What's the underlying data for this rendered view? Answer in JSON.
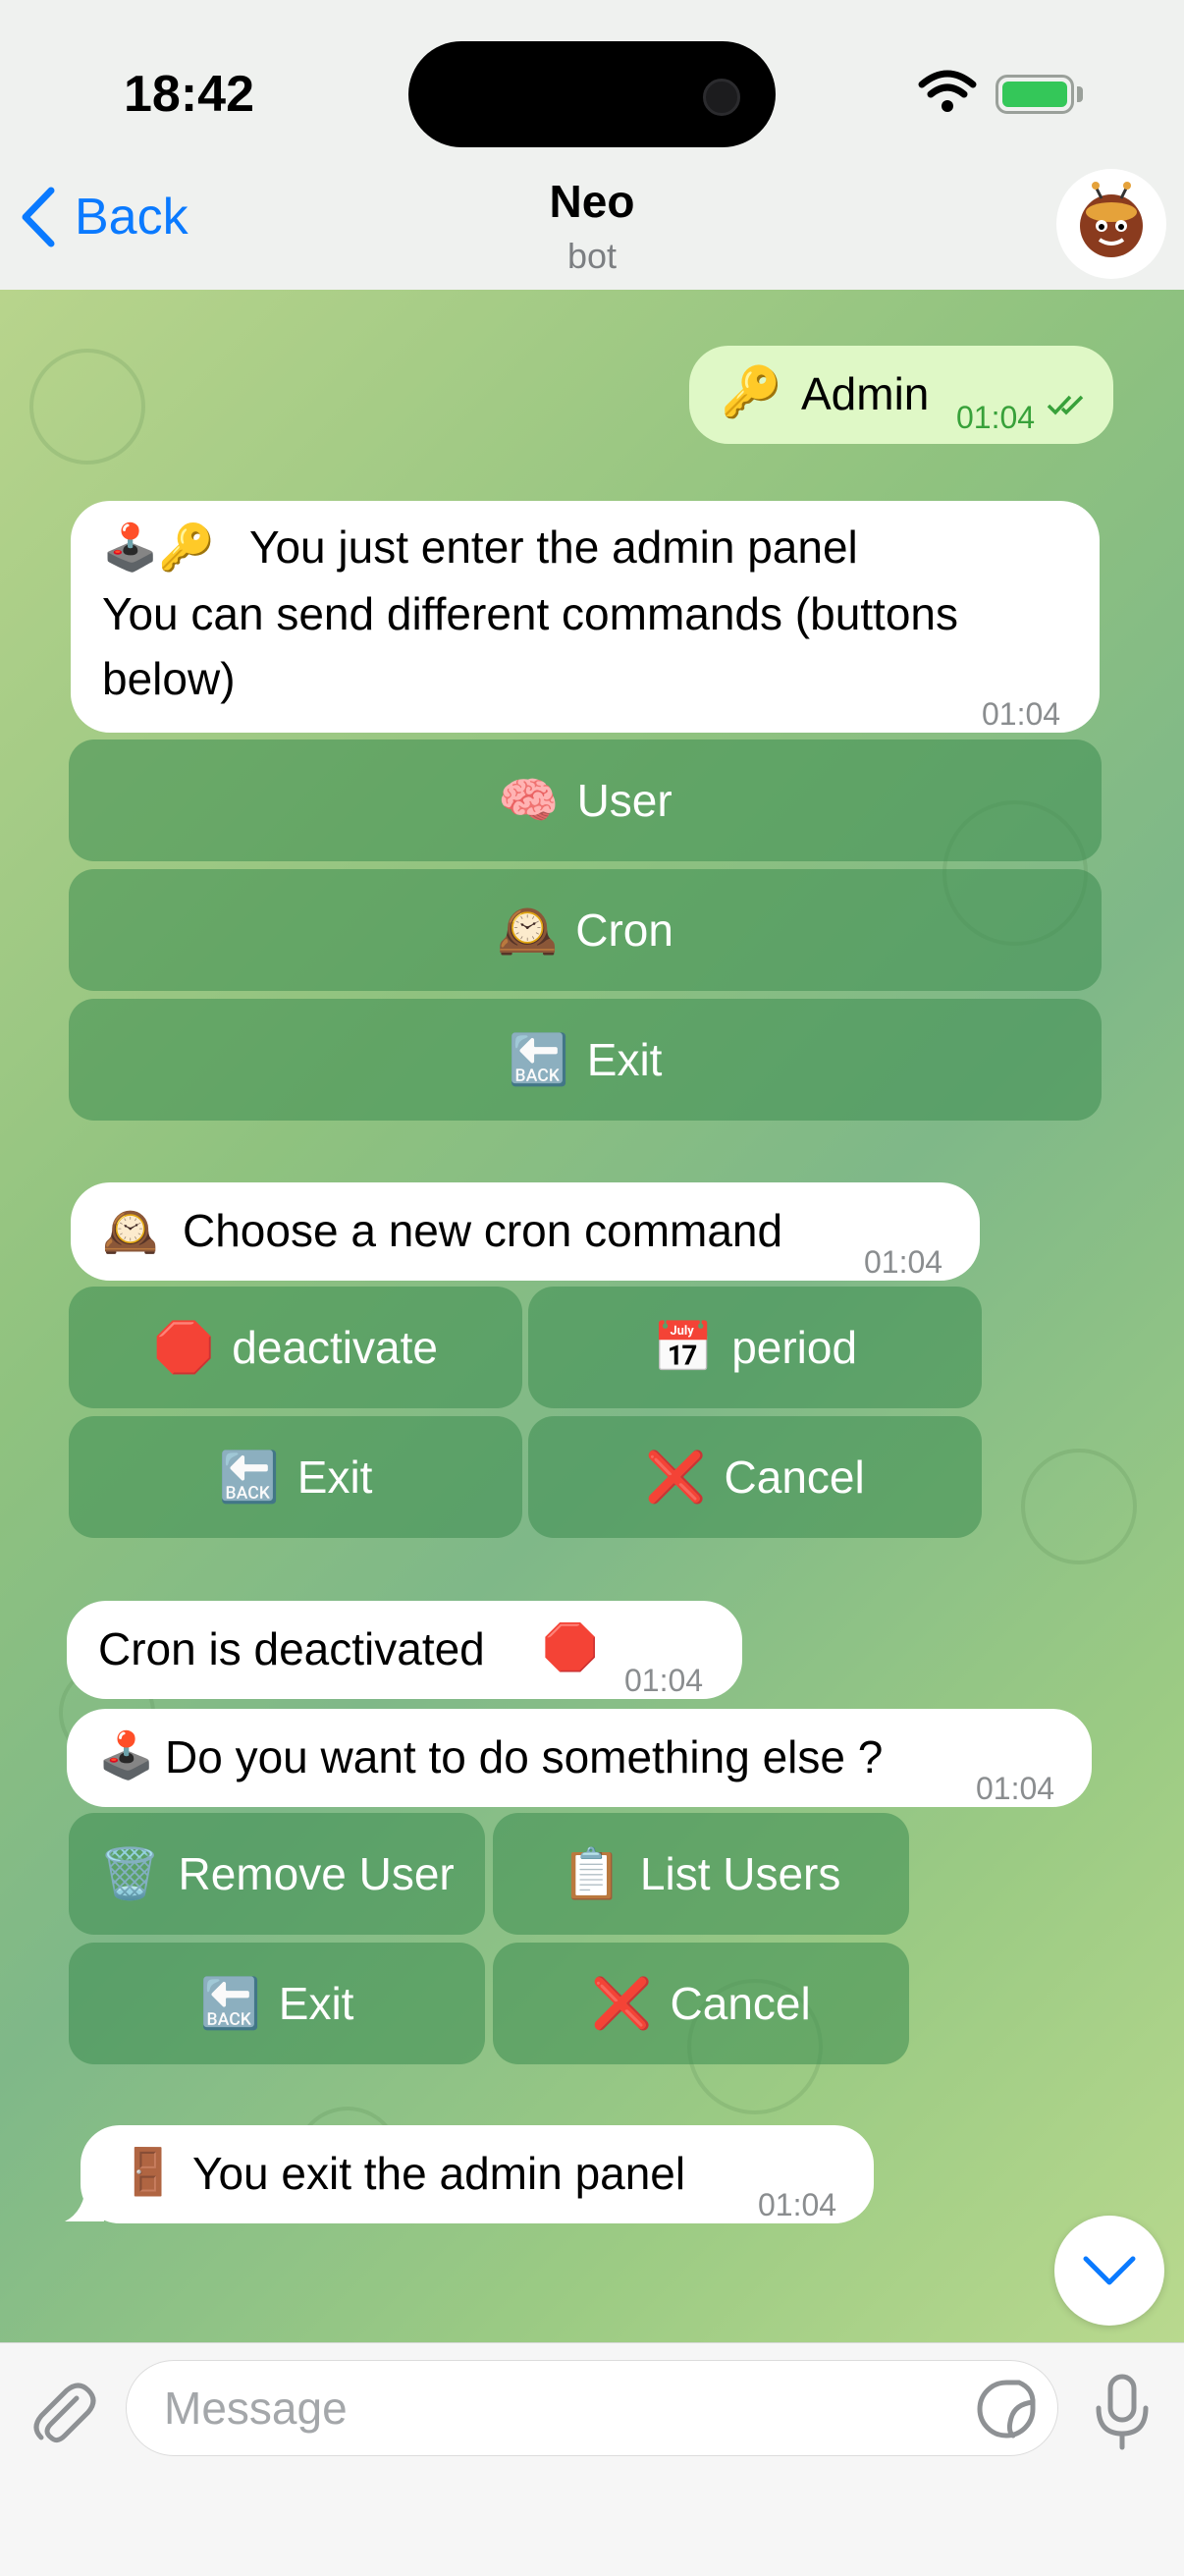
{
  "status_bar": {
    "time": "18:42"
  },
  "header": {
    "back_label": "Back",
    "title": "Neo",
    "subtitle": "bot"
  },
  "messages": {
    "m1": {
      "emoji": "🔑",
      "text": "Admin",
      "time": "01:04"
    },
    "m2": {
      "emoji": "🕹️🔑",
      "line1": "You just enter the admin panel",
      "line2": "You can send different commands (buttons",
      "line3": "below)",
      "time": "01:04",
      "buttons": [
        {
          "icon": "🧠",
          "label": "User"
        },
        {
          "icon": "🕰️",
          "label": "Cron"
        },
        {
          "icon": "🔙",
          "label": "Exit"
        }
      ]
    },
    "m3": {
      "emoji": "🕰️",
      "text": "Choose a new cron command",
      "time": "01:04",
      "buttons": [
        {
          "icon": "🛑",
          "label": "deactivate"
        },
        {
          "icon": "📅",
          "label": "period"
        },
        {
          "icon": "🔙",
          "label": "Exit"
        },
        {
          "icon": "❌",
          "label": "Cancel"
        }
      ]
    },
    "m4": {
      "text": "Cron is deactivated",
      "emoji": "🛑",
      "time": "01:04"
    },
    "m5": {
      "emoji": "🕹️",
      "text": "Do you want to do something else ?",
      "time": "01:04",
      "buttons": [
        {
          "icon": "🗑️",
          "label": "Remove User"
        },
        {
          "icon": "📋",
          "label": "List Users"
        },
        {
          "icon": "🔙",
          "label": "Exit"
        },
        {
          "icon": "❌",
          "label": "Cancel"
        }
      ]
    },
    "m6": {
      "emoji": "🚪",
      "text": "You exit the admin panel",
      "time": "01:04"
    }
  },
  "input": {
    "placeholder": "Message"
  },
  "colors": {
    "accent": "#0a7aff",
    "outgoing_bubble": "#dff8c6",
    "keyboard_button": "#4f9a5f"
  }
}
